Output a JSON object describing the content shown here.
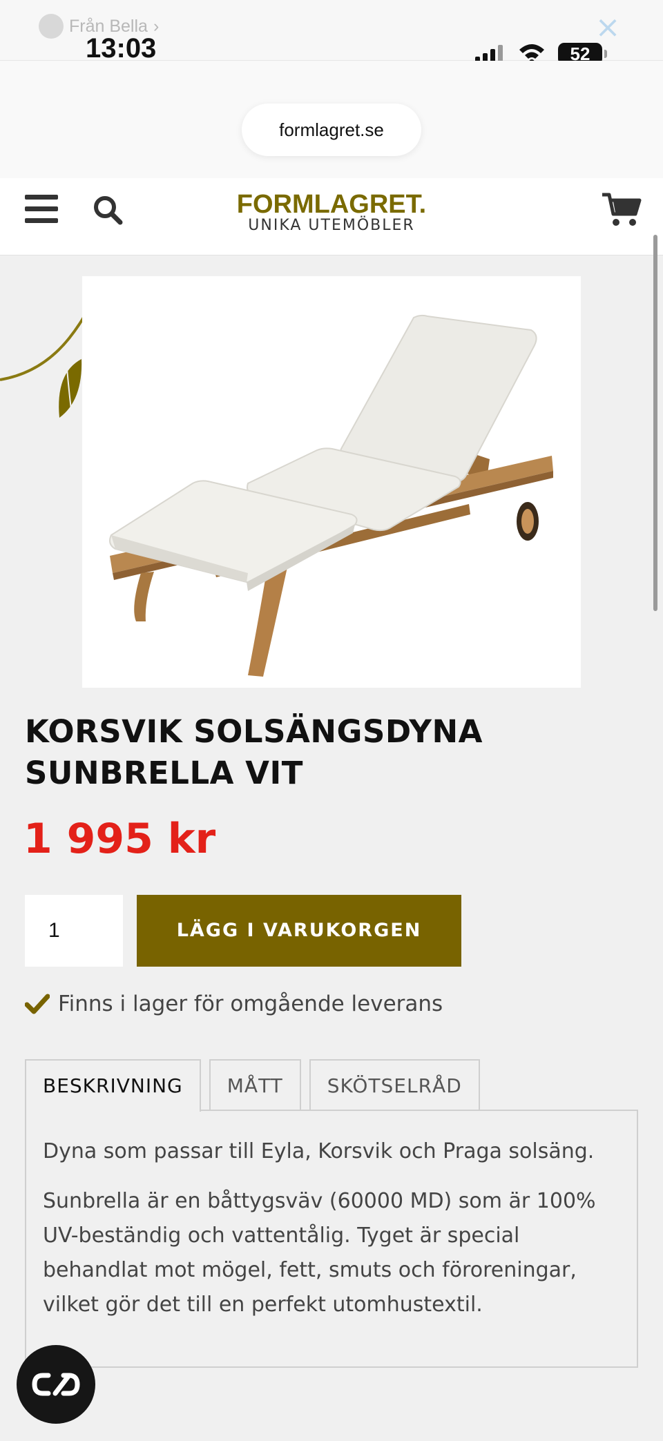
{
  "status_bar": {
    "back_label": "Från Bella",
    "time": "13:03",
    "battery": "52",
    "close_symbol": "×"
  },
  "browser": {
    "url": "formlagret.se"
  },
  "header": {
    "logo_main": "FORMLAGRET.",
    "logo_sub": "UNIKA UTEMÖBLER",
    "icons": [
      "menu-icon",
      "search-icon",
      "cart-icon"
    ]
  },
  "product": {
    "title": "KORSVIK SOLSÄNGSDYNA SUNBRELLA VIT",
    "price": "1 995 kr",
    "quantity": "1",
    "add_to_cart_label": "LÄGG I VARUKORGEN",
    "stock_text": "Finns i lager för omgående leverans"
  },
  "tabs": {
    "items": [
      {
        "label": "BESKRIVNING",
        "active": true
      },
      {
        "label": "MÅTT",
        "active": false
      },
      {
        "label": "SKÖTSELRÅD",
        "active": false
      }
    ],
    "description": [
      "Dyna som passar till Eyla, Korsvik och Praga solsäng.",
      "Sunbrella är en båttygsväv (60000 MD) som är 100% UV-beständig och vattentålig. Tyget är special behandlat mot mögel, fett, smuts och föroreningar, vilket gör det till en perfekt utomhustextil."
    ]
  },
  "colors": {
    "brand": "#786300",
    "price": "#e32119",
    "background": "#f0f0f0"
  }
}
